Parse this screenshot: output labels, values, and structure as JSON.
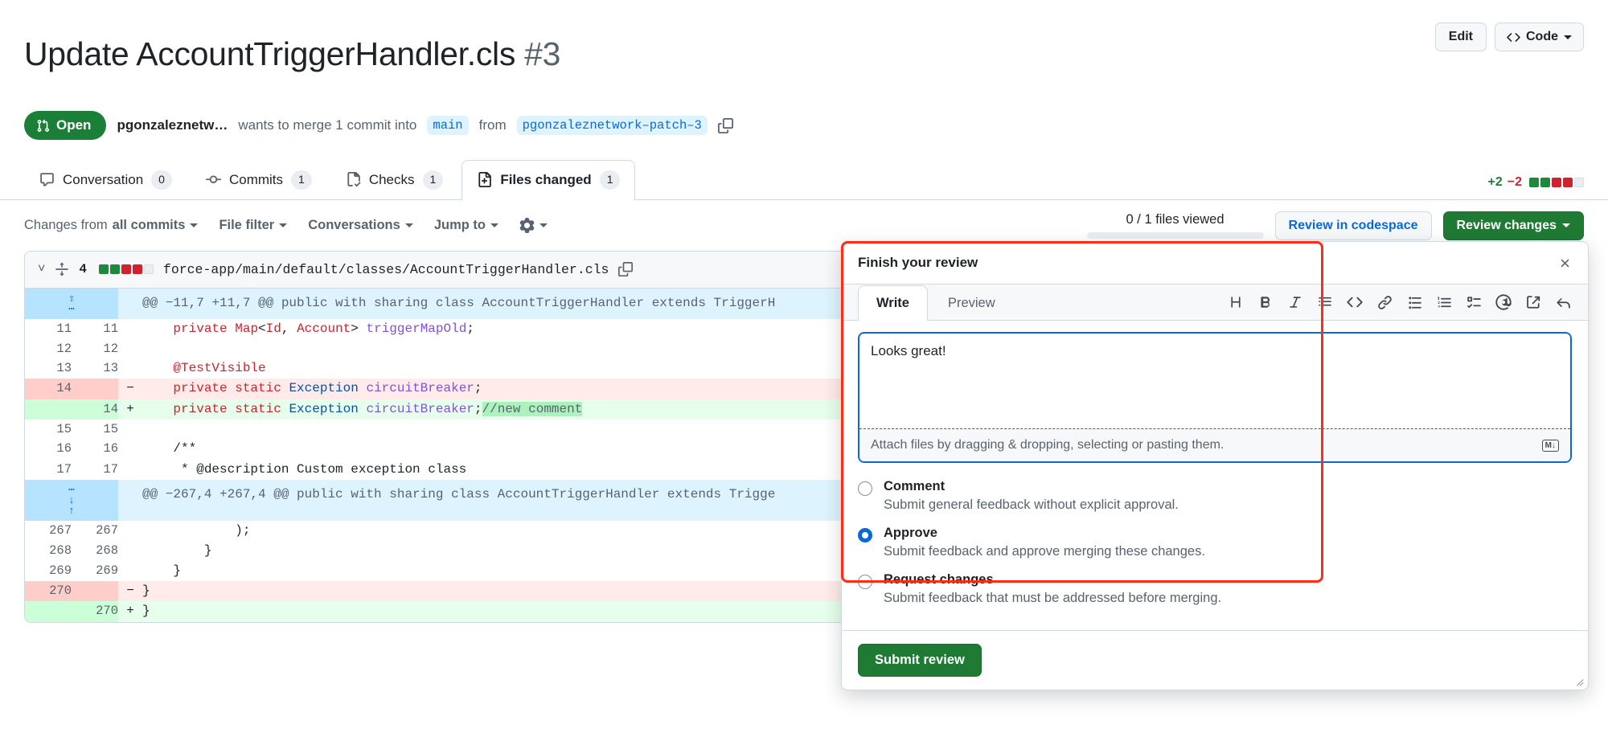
{
  "header": {
    "title": "Update AccountTriggerHandler.cls",
    "number": "#3",
    "edit_label": "Edit",
    "code_label": "Code"
  },
  "meta": {
    "state": "Open",
    "author": "pgonzaleznetw…",
    "action_text": "wants to merge 1 commit into",
    "base_branch": "main",
    "from_text": "from",
    "head_branch": "pgonzaleznetwork–patch–3"
  },
  "tabs": [
    {
      "label": "Conversation",
      "count": "0",
      "icon": "comment-icon",
      "active": false
    },
    {
      "label": "Commits",
      "count": "1",
      "icon": "commit-icon",
      "active": false
    },
    {
      "label": "Checks",
      "count": "1",
      "icon": "checks-icon",
      "active": false
    },
    {
      "label": "Files changed",
      "count": "1",
      "icon": "file-diff-icon",
      "active": true
    }
  ],
  "diffstat": {
    "additions": "+2",
    "deletions": "−2",
    "blocks": [
      "g",
      "g",
      "r",
      "r",
      "n"
    ]
  },
  "toolbar": {
    "changes_from_prefix": "Changes from",
    "changes_from_value": "all commits",
    "file_filter": "File filter",
    "conversations": "Conversations",
    "jump_to": "Jump to",
    "settings_icon": "gear-icon",
    "files_viewed": "0 / 1 files viewed",
    "review_codespace": "Review in codespace",
    "review_changes": "Review changes"
  },
  "file": {
    "change_count": "4",
    "path": "force-app/main/default/classes/AccountTriggerHandler.cls",
    "blocks": [
      "g",
      "g",
      "r",
      "r",
      "n"
    ],
    "copy_icon": "copy-icon",
    "collapse_icon": "chevron-down-icon",
    "expand_icon": "unfold-icon"
  },
  "diff_rows": [
    {
      "type": "hunk",
      "expander": "up",
      "old": "",
      "new": "",
      "sign": "",
      "code": "@@ −11,7 +11,7 @@ public with sharing class AccountTriggerHandler extends TriggerH"
    },
    {
      "type": "ctx",
      "old": "11",
      "new": "11",
      "sign": "",
      "code": "    private Map<Id, Account> triggerMapOld;"
    },
    {
      "type": "ctx",
      "old": "12",
      "new": "12",
      "sign": "",
      "code": ""
    },
    {
      "type": "ctx",
      "old": "13",
      "new": "13",
      "sign": "",
      "code": "    @TestVisible"
    },
    {
      "type": "del",
      "old": "14",
      "new": "",
      "sign": "−",
      "code": "    private static Exception circuitBreaker;"
    },
    {
      "type": "add",
      "old": "",
      "new": "14",
      "sign": "+",
      "code": "    private static Exception circuitBreaker;//new comment"
    },
    {
      "type": "ctx",
      "old": "15",
      "new": "15",
      "sign": "",
      "code": ""
    },
    {
      "type": "ctx",
      "old": "16",
      "new": "16",
      "sign": "",
      "code": "    /**"
    },
    {
      "type": "ctx",
      "old": "17",
      "new": "17",
      "sign": "",
      "code": "     * @description Custom exception class"
    },
    {
      "type": "hunk",
      "expander": "both",
      "old": "",
      "new": "",
      "sign": "",
      "code": "@@ −267,4 +267,4 @@ public with sharing class AccountTriggerHandler extends Trigge"
    },
    {
      "type": "ctx",
      "old": "267",
      "new": "267",
      "sign": "",
      "code": "            );"
    },
    {
      "type": "ctx",
      "old": "268",
      "new": "268",
      "sign": "",
      "code": "        }"
    },
    {
      "type": "ctx",
      "old": "269",
      "new": "269",
      "sign": "",
      "code": "    }"
    },
    {
      "type": "del",
      "old": "270",
      "new": "",
      "sign": "−",
      "code": "}"
    },
    {
      "type": "add",
      "old": "",
      "new": "270",
      "sign": "+",
      "code": "}"
    }
  ],
  "review_dialog": {
    "title": "Finish your review",
    "close_icon": "close-icon",
    "write_tab": "Write",
    "preview_tab": "Preview",
    "md_tools": [
      "heading-icon",
      "bold-icon",
      "italic-icon",
      "quote-icon",
      "code-icon",
      "link-icon",
      "unordered-list-icon",
      "ordered-list-icon",
      "task-list-icon",
      "mention-icon",
      "reference-icon",
      "reply-icon"
    ],
    "comment_value": "Looks great!",
    "attach_hint": "Attach files by dragging & dropping, selecting or pasting them.",
    "markdown_badge": "M↓",
    "options": [
      {
        "label": "Comment",
        "desc": "Submit general feedback without explicit approval.",
        "checked": false
      },
      {
        "label": "Approve",
        "desc": "Submit feedback and approve merging these changes.",
        "checked": true
      },
      {
        "label": "Request changes",
        "desc": "Submit feedback that must be addressed before merging.",
        "checked": false
      }
    ],
    "submit_label": "Submit review"
  },
  "colors": {
    "green": "#1f883d",
    "red": "#cf222e",
    "blue": "#0969da",
    "annotation_red": "#ff2d16"
  }
}
